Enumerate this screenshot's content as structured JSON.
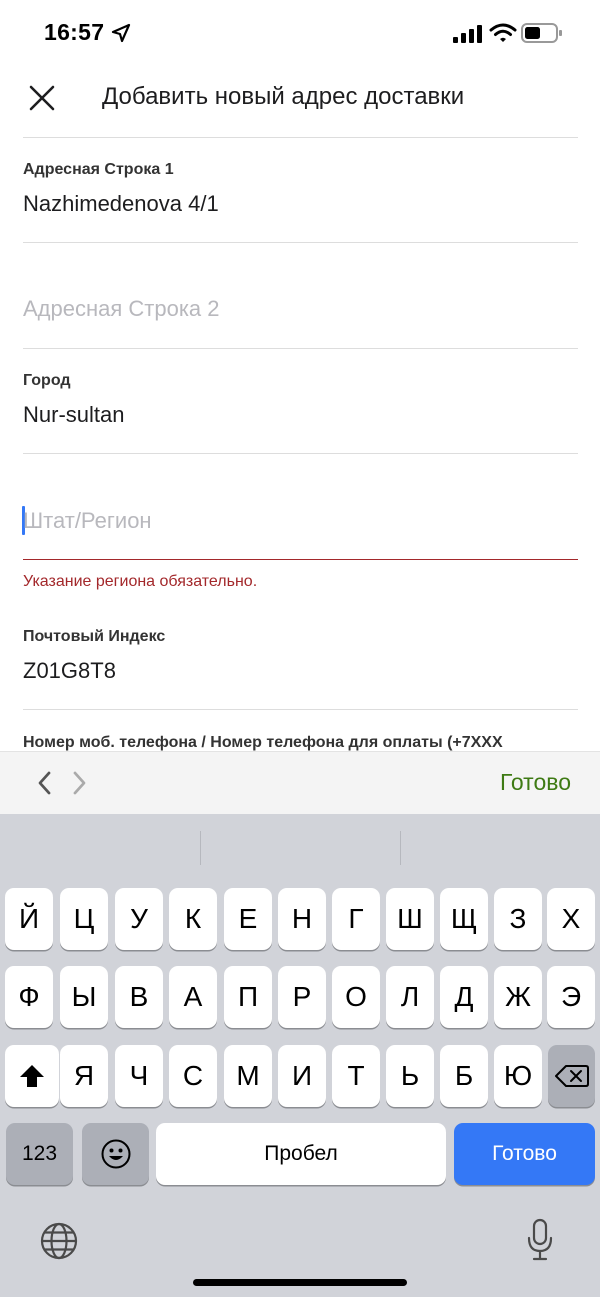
{
  "status_bar": {
    "time": "16:57",
    "icons": [
      "location-arrow-icon",
      "cellular-signal-icon",
      "wifi-icon",
      "battery-icon"
    ]
  },
  "header": {
    "close_icon": "close-icon",
    "title": "Добавить новый адрес доставки"
  },
  "form": {
    "address_line_1": {
      "label": "Адресная Строка 1",
      "value": "Nazhimedenova 4/1"
    },
    "address_line_2": {
      "placeholder": "Адресная Строка 2"
    },
    "city": {
      "label": "Город",
      "value": "Nur-sultan"
    },
    "state_region": {
      "placeholder": "Штат/Регион",
      "error": "Указание региона обязательно."
    },
    "postal_code": {
      "label": "Почтовый Индекс",
      "value": "Z01G8T8"
    },
    "phone": {
      "label": "Номер моб. телефона / Номер телефона для оплаты (+7XXX"
    }
  },
  "accessory_bar": {
    "prev_icon": "chevron-left-icon",
    "next_icon": "chevron-right-icon",
    "done_label": "Готово"
  },
  "keyboard": {
    "row1": [
      "Й",
      "Ц",
      "У",
      "К",
      "Е",
      "Н",
      "Г",
      "Ш",
      "Щ",
      "З",
      "Х"
    ],
    "row2": [
      "Ф",
      "Ы",
      "В",
      "А",
      "П",
      "Р",
      "О",
      "Л",
      "Д",
      "Ж",
      "Э"
    ],
    "row3": [
      "Я",
      "Ч",
      "С",
      "М",
      "И",
      "Т",
      "Ь",
      "Б",
      "Ю"
    ],
    "numbers_label": "123",
    "space_label": "Пробел",
    "return_label": "Готово",
    "icons": [
      "shift-icon",
      "backspace-icon",
      "emoji-icon",
      "globe-icon",
      "microphone-icon"
    ]
  },
  "colors": {
    "accent_green": "#3e7a14",
    "error_red": "#a3282b",
    "keyboard_blue": "#3478f6",
    "placeholder_gray": "#b8b8bd"
  }
}
